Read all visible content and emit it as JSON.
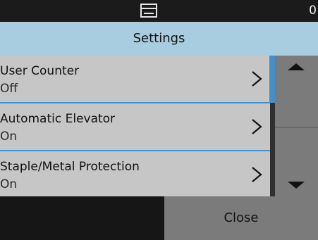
{
  "status_bar": {
    "tray_icon": "output-tray-icon",
    "counter": "0"
  },
  "header": {
    "title": "Settings"
  },
  "settings": [
    {
      "label": "User Counter",
      "value": "Off"
    },
    {
      "label": "Automatic Elevator",
      "value": "On"
    },
    {
      "label": "Staple/Metal Protection",
      "value": "On"
    }
  ],
  "scrollbar": {
    "up_icon": "triangle-up-icon",
    "down_icon": "triangle-down-icon"
  },
  "footer": {
    "close_label": "Close"
  },
  "colors": {
    "header_bg": "#a8cde0",
    "accent": "#4a8ec4",
    "item_bg": "#c6c6c6",
    "button_bg": "#7b7b7b"
  }
}
